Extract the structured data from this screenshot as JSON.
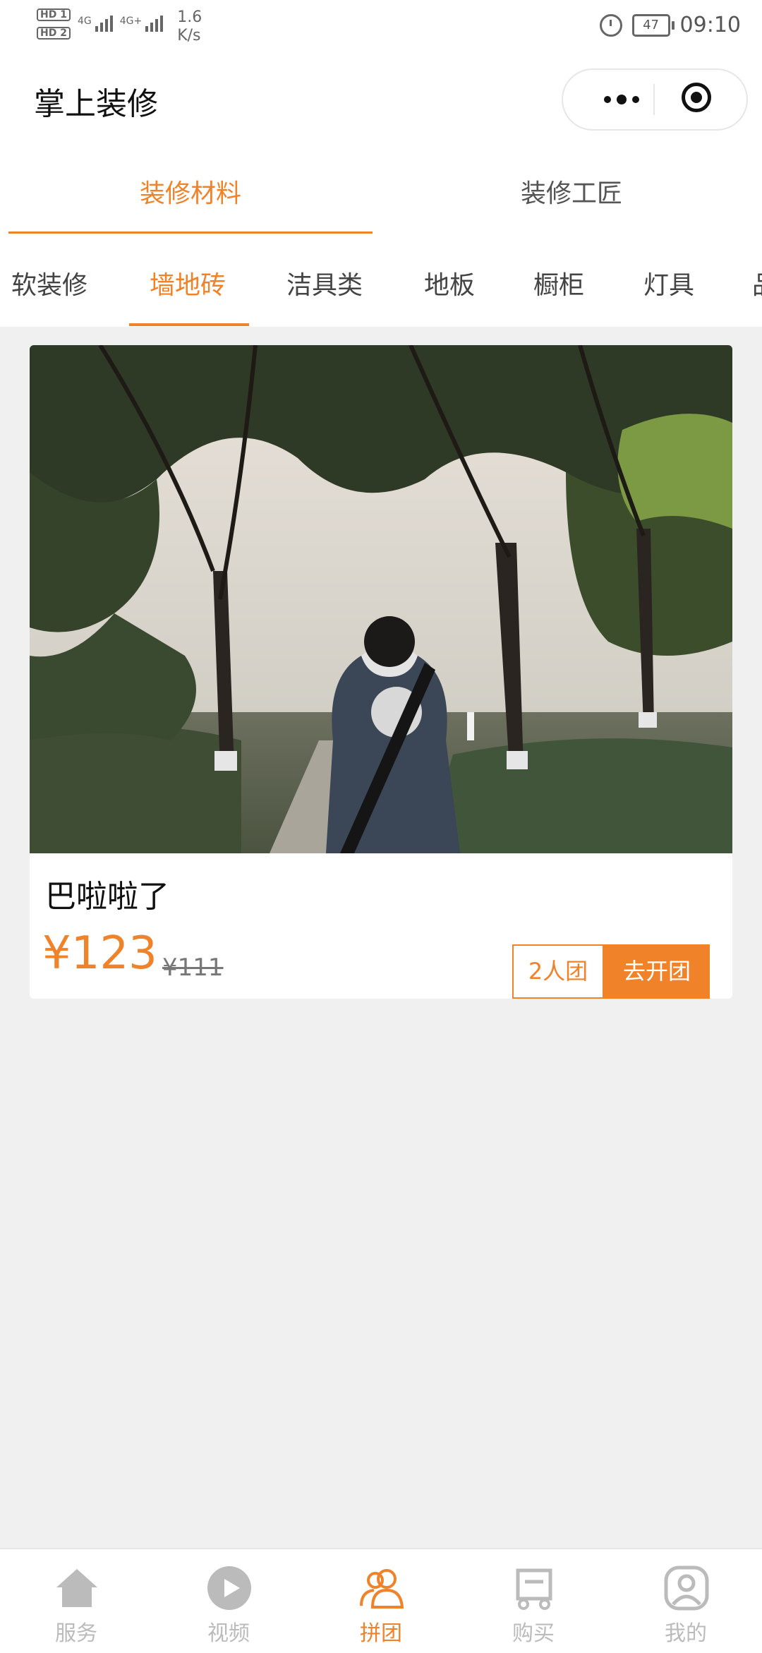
{
  "status_bar": {
    "sim1": "HD 1",
    "sim2": "HD 2",
    "net1": "4G",
    "net2": "4G+",
    "speed_value": "1.6",
    "speed_unit": "K/s",
    "battery": "47",
    "time": "09:10"
  },
  "navbar": {
    "title": "掌上装修",
    "more_icon": "more-dots-icon",
    "close_icon": "target-icon"
  },
  "main_tabs": [
    {
      "label": "装修材料",
      "active": true
    },
    {
      "label": "装修工匠",
      "active": false
    }
  ],
  "sub_tabs": [
    {
      "label": "软装修",
      "active": false
    },
    {
      "label": "墙地砖",
      "active": true
    },
    {
      "label": "洁具类",
      "active": false
    },
    {
      "label": "地板",
      "active": false
    },
    {
      "label": "橱柜",
      "active": false
    },
    {
      "label": "灯具",
      "active": false
    },
    {
      "label": "品",
      "active": false
    }
  ],
  "product": {
    "name": "巴啦啦了",
    "price": "¥123",
    "original_price": "¥111",
    "group_size": "2人团",
    "group_button": "去开团"
  },
  "tab_bar": [
    {
      "label": "服务",
      "icon": "home-icon",
      "active": false
    },
    {
      "label": "视频",
      "icon": "play-icon",
      "active": false
    },
    {
      "label": "拼团",
      "icon": "group-icon",
      "active": true
    },
    {
      "label": "购买",
      "icon": "cart-icon",
      "active": false
    },
    {
      "label": "我的",
      "icon": "user-icon",
      "active": false
    }
  ],
  "colors": {
    "accent": "#f0832a",
    "inactive": "#bbbbbb",
    "background": "#f0f0f0"
  }
}
